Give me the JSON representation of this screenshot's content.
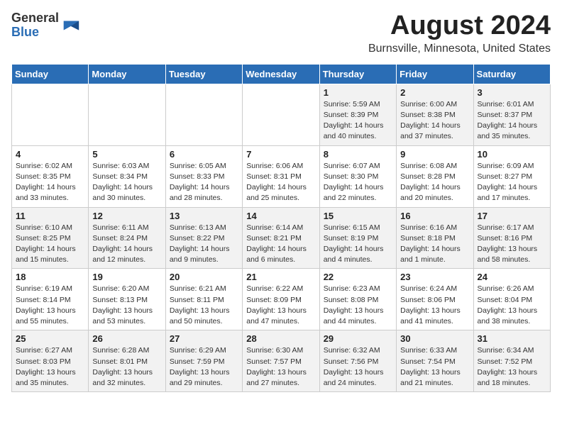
{
  "header": {
    "logo_line1": "General",
    "logo_line2": "Blue",
    "month_title": "August 2024",
    "location": "Burnsville, Minnesota, United States"
  },
  "days_of_week": [
    "Sunday",
    "Monday",
    "Tuesday",
    "Wednesday",
    "Thursday",
    "Friday",
    "Saturday"
  ],
  "weeks": [
    [
      {
        "day": "",
        "info": ""
      },
      {
        "day": "",
        "info": ""
      },
      {
        "day": "",
        "info": ""
      },
      {
        "day": "",
        "info": ""
      },
      {
        "day": "1",
        "info": "Sunrise: 5:59 AM\nSunset: 8:39 PM\nDaylight: 14 hours\nand 40 minutes."
      },
      {
        "day": "2",
        "info": "Sunrise: 6:00 AM\nSunset: 8:38 PM\nDaylight: 14 hours\nand 37 minutes."
      },
      {
        "day": "3",
        "info": "Sunrise: 6:01 AM\nSunset: 8:37 PM\nDaylight: 14 hours\nand 35 minutes."
      }
    ],
    [
      {
        "day": "4",
        "info": "Sunrise: 6:02 AM\nSunset: 8:35 PM\nDaylight: 14 hours\nand 33 minutes."
      },
      {
        "day": "5",
        "info": "Sunrise: 6:03 AM\nSunset: 8:34 PM\nDaylight: 14 hours\nand 30 minutes."
      },
      {
        "day": "6",
        "info": "Sunrise: 6:05 AM\nSunset: 8:33 PM\nDaylight: 14 hours\nand 28 minutes."
      },
      {
        "day": "7",
        "info": "Sunrise: 6:06 AM\nSunset: 8:31 PM\nDaylight: 14 hours\nand 25 minutes."
      },
      {
        "day": "8",
        "info": "Sunrise: 6:07 AM\nSunset: 8:30 PM\nDaylight: 14 hours\nand 22 minutes."
      },
      {
        "day": "9",
        "info": "Sunrise: 6:08 AM\nSunset: 8:28 PM\nDaylight: 14 hours\nand 20 minutes."
      },
      {
        "day": "10",
        "info": "Sunrise: 6:09 AM\nSunset: 8:27 PM\nDaylight: 14 hours\nand 17 minutes."
      }
    ],
    [
      {
        "day": "11",
        "info": "Sunrise: 6:10 AM\nSunset: 8:25 PM\nDaylight: 14 hours\nand 15 minutes."
      },
      {
        "day": "12",
        "info": "Sunrise: 6:11 AM\nSunset: 8:24 PM\nDaylight: 14 hours\nand 12 minutes."
      },
      {
        "day": "13",
        "info": "Sunrise: 6:13 AM\nSunset: 8:22 PM\nDaylight: 14 hours\nand 9 minutes."
      },
      {
        "day": "14",
        "info": "Sunrise: 6:14 AM\nSunset: 8:21 PM\nDaylight: 14 hours\nand 6 minutes."
      },
      {
        "day": "15",
        "info": "Sunrise: 6:15 AM\nSunset: 8:19 PM\nDaylight: 14 hours\nand 4 minutes."
      },
      {
        "day": "16",
        "info": "Sunrise: 6:16 AM\nSunset: 8:18 PM\nDaylight: 14 hours\nand 1 minute."
      },
      {
        "day": "17",
        "info": "Sunrise: 6:17 AM\nSunset: 8:16 PM\nDaylight: 13 hours\nand 58 minutes."
      }
    ],
    [
      {
        "day": "18",
        "info": "Sunrise: 6:19 AM\nSunset: 8:14 PM\nDaylight: 13 hours\nand 55 minutes."
      },
      {
        "day": "19",
        "info": "Sunrise: 6:20 AM\nSunset: 8:13 PM\nDaylight: 13 hours\nand 53 minutes."
      },
      {
        "day": "20",
        "info": "Sunrise: 6:21 AM\nSunset: 8:11 PM\nDaylight: 13 hours\nand 50 minutes."
      },
      {
        "day": "21",
        "info": "Sunrise: 6:22 AM\nSunset: 8:09 PM\nDaylight: 13 hours\nand 47 minutes."
      },
      {
        "day": "22",
        "info": "Sunrise: 6:23 AM\nSunset: 8:08 PM\nDaylight: 13 hours\nand 44 minutes."
      },
      {
        "day": "23",
        "info": "Sunrise: 6:24 AM\nSunset: 8:06 PM\nDaylight: 13 hours\nand 41 minutes."
      },
      {
        "day": "24",
        "info": "Sunrise: 6:26 AM\nSunset: 8:04 PM\nDaylight: 13 hours\nand 38 minutes."
      }
    ],
    [
      {
        "day": "25",
        "info": "Sunrise: 6:27 AM\nSunset: 8:03 PM\nDaylight: 13 hours\nand 35 minutes."
      },
      {
        "day": "26",
        "info": "Sunrise: 6:28 AM\nSunset: 8:01 PM\nDaylight: 13 hours\nand 32 minutes."
      },
      {
        "day": "27",
        "info": "Sunrise: 6:29 AM\nSunset: 7:59 PM\nDaylight: 13 hours\nand 29 minutes."
      },
      {
        "day": "28",
        "info": "Sunrise: 6:30 AM\nSunset: 7:57 PM\nDaylight: 13 hours\nand 27 minutes."
      },
      {
        "day": "29",
        "info": "Sunrise: 6:32 AM\nSunset: 7:56 PM\nDaylight: 13 hours\nand 24 minutes."
      },
      {
        "day": "30",
        "info": "Sunrise: 6:33 AM\nSunset: 7:54 PM\nDaylight: 13 hours\nand 21 minutes."
      },
      {
        "day": "31",
        "info": "Sunrise: 6:34 AM\nSunset: 7:52 PM\nDaylight: 13 hours\nand 18 minutes."
      }
    ]
  ]
}
